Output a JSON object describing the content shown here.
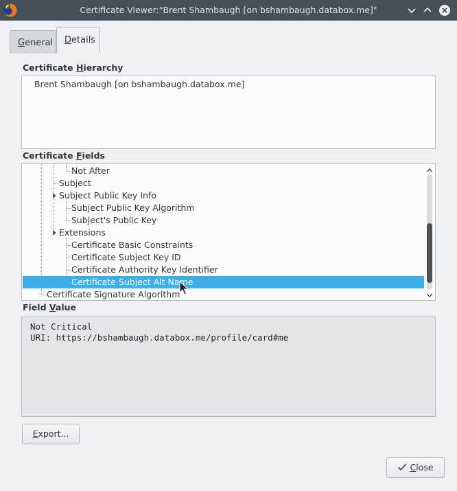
{
  "window": {
    "title": "Certificate Viewer:\"Brent Shambaugh [on bshambaugh.databox.me]\""
  },
  "tabs": [
    {
      "pre": "",
      "u": "G",
      "post": "eneral",
      "active": false
    },
    {
      "pre": "",
      "u": "D",
      "post": "etails",
      "active": true
    }
  ],
  "hierarchy": {
    "label_pre": "Certificate ",
    "label_u": "H",
    "label_post": "ierarchy",
    "item": "Brent Shambaugh [on bshambaugh.databox.me]"
  },
  "fields": {
    "label_pre": "Certificate ",
    "label_u": "F",
    "label_post": "ields",
    "rows": [
      "Not After",
      "Subject",
      "Subject Public Key Info",
      "Subject Public Key Algorithm",
      "Subject's Public Key",
      "Extensions",
      "Certificate Basic Constraints",
      "Certificate Subject Key ID",
      "Certificate Authority Key Identifier",
      "Certificate Subject Alt Name",
      "Certificate Signature Algorithm"
    ],
    "selected": "Certificate Subject Alt Name"
  },
  "field_value": {
    "label_pre": "Field ",
    "label_u": "V",
    "label_post": "alue",
    "lines": [
      "Not Critical",
      "URI: https://bshambaugh.databox.me/profile/card#me"
    ]
  },
  "buttons": {
    "export_u": "E",
    "export_rest": "xport...",
    "close_u": "C",
    "close_rest": "lose"
  },
  "colors": {
    "titlebar": "#475057",
    "selection": "#3daee9",
    "background": "#eff0f1"
  },
  "icons": [
    "firefox-icon",
    "minimize-icon",
    "maximize-icon",
    "close-icon",
    "expand-arrow-icon",
    "checkmark-icon",
    "scroll-up-icon",
    "scroll-down-icon",
    "mouse-cursor-icon"
  ]
}
